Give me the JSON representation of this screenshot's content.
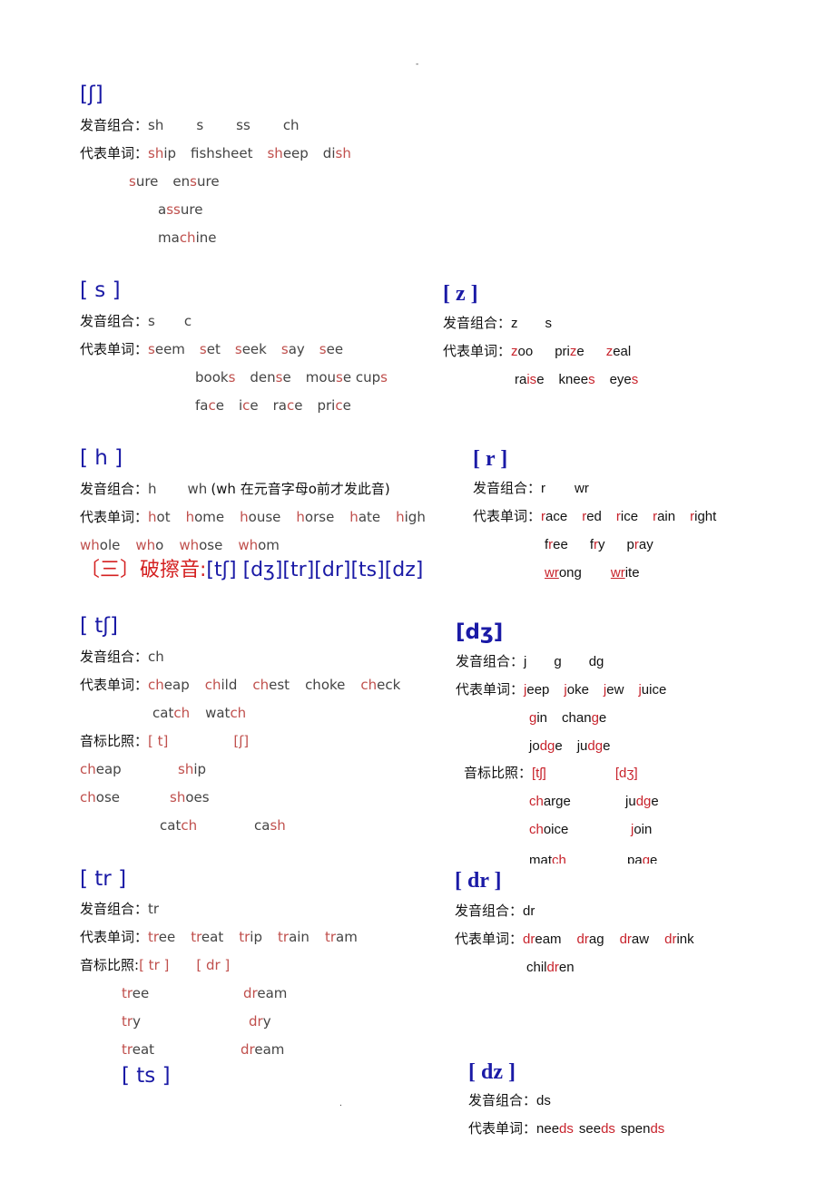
{
  "page_marks": {
    "top": "-",
    "bottom": "."
  },
  "labels": {
    "combo": "发音组合：",
    "words": "代表单词：",
    "compare": "音标比照：",
    "compare_tight": "音标比照:"
  },
  "heading": {
    "prefix": "〔三〕破擦音:",
    "symbols": "[tʃ] [dʒ][tr][dr][ts][dz]"
  },
  "colors": {
    "symbol": "#1a1aa6",
    "highlight": "#c0504d",
    "heading": "#d42020"
  },
  "sh": {
    "symbol": "[ʃ]",
    "combos": [
      "sh",
      "s",
      "ss",
      "ch"
    ],
    "words": [
      [
        "",
        "sh",
        "ip"
      ],
      [
        "fishsheet"
      ],
      [
        "",
        "sh",
        "eep"
      ],
      [
        "di",
        "sh"
      ]
    ],
    "words2": [
      [
        "",
        "s",
        "ure"
      ],
      [
        "en",
        "s",
        "ure"
      ]
    ],
    "words3": [
      [
        "a",
        "ss",
        "ure"
      ]
    ],
    "words4": [
      [
        "ma",
        "ch",
        "ine"
      ]
    ]
  },
  "s": {
    "symbol": "[ s ]",
    "combos": [
      "s",
      "c"
    ],
    "words": [
      [
        "",
        "s",
        "eem"
      ],
      [
        "",
        "s",
        "et"
      ],
      [
        "",
        "s",
        "eek"
      ],
      [
        "",
        "s",
        "ay"
      ],
      [
        "",
        "s",
        "ee"
      ]
    ],
    "words2": [
      [
        "book",
        "s"
      ],
      [
        "den",
        "s",
        "e"
      ],
      [
        "mou",
        "s",
        "e cup",
        "s"
      ]
    ],
    "words3": [
      [
        "fa",
        "c",
        "e"
      ],
      [
        "i",
        "c",
        "e"
      ],
      [
        "ra",
        "c",
        "e"
      ],
      [
        "pri",
        "c",
        "e"
      ]
    ]
  },
  "z": {
    "symbol": "[ z ]",
    "combos": [
      "z",
      "s"
    ],
    "words": [
      [
        "",
        "z",
        "oo"
      ],
      [
        "pri",
        "z",
        "e"
      ],
      [
        "",
        "z",
        "eal"
      ]
    ],
    "words2": [
      [
        "ra",
        "is",
        "e"
      ],
      [
        "knee",
        "s"
      ],
      [
        "eye",
        "s"
      ]
    ]
  },
  "h": {
    "symbol": "[ h ]",
    "combos": [
      "h",
      "wh"
    ],
    "note": "(wh  在元音字母o前才发此音)",
    "words": [
      [
        "",
        "h",
        "ot"
      ],
      [
        "",
        "h",
        "ome"
      ],
      [
        "",
        "h",
        "ouse"
      ],
      [
        "",
        "h",
        "orse"
      ],
      [
        "",
        "h",
        "ate"
      ],
      [
        "",
        "h",
        "igh"
      ]
    ],
    "words2": [
      [
        "",
        "wh",
        "ole"
      ],
      [
        "",
        "wh",
        "o"
      ],
      [
        "",
        "wh",
        "ose"
      ],
      [
        "",
        "wh",
        "om"
      ]
    ]
  },
  "r": {
    "symbol": "[ r ]",
    "combos": [
      "r",
      "wr"
    ],
    "words": [
      [
        "",
        "r",
        "ace"
      ],
      [
        "",
        "r",
        "ed"
      ],
      [
        "",
        "r",
        "ice"
      ],
      [
        "",
        "r",
        "ain"
      ],
      [
        "",
        "r",
        "ight"
      ]
    ],
    "words2": [
      [
        "f",
        "r",
        "ee"
      ],
      [
        "f",
        "r",
        "y"
      ],
      [
        "p",
        "r",
        "ay"
      ]
    ],
    "words3": [
      [
        "",
        "wr",
        "ong"
      ],
      [
        "",
        "wr",
        "ite"
      ]
    ]
  },
  "tsh": {
    "symbol": "[ tʃ]",
    "combos": [
      "ch"
    ],
    "words": [
      [
        "",
        "ch",
        "eap"
      ],
      [
        "",
        "ch",
        "ild"
      ],
      [
        "",
        "ch",
        "est"
      ],
      [
        "choke"
      ],
      [
        "",
        "ch",
        "eck"
      ]
    ],
    "words2": [
      [
        "cat",
        "ch"
      ],
      [
        "wat",
        "ch"
      ]
    ],
    "compare": [
      [
        "",
        "[ t]"
      ],
      [
        "",
        "[ʃ]"
      ]
    ],
    "pairs": [
      [
        [
          "",
          "ch",
          "eap"
        ],
        [
          "",
          "sh",
          "ip"
        ]
      ],
      [
        [
          "",
          "ch",
          "ose"
        ],
        [
          "",
          "sh",
          "oes"
        ]
      ],
      [
        [
          "cat",
          "ch"
        ],
        [
          "ca",
          "sh"
        ]
      ]
    ]
  },
  "dzh": {
    "symbol": "[dʒ]",
    "combos": [
      "j",
      "g",
      "dg"
    ],
    "words": [
      [
        "",
        "j",
        "eep"
      ],
      [
        "",
        "j",
        "oke"
      ],
      [
        "",
        "j",
        "ew"
      ],
      [
        "",
        "j",
        "uice"
      ]
    ],
    "words2": [
      [
        "",
        "g",
        "in"
      ],
      [
        "chan",
        "g",
        "e"
      ]
    ],
    "words3": [
      [
        "jo",
        "dg",
        "e"
      ],
      [
        "ju",
        "dg",
        "e"
      ]
    ],
    "compare": [
      [
        "",
        "[tʃ]"
      ],
      [
        "",
        "[dʒ]"
      ]
    ],
    "pairs": [
      [
        [
          "",
          "ch",
          "arge"
        ],
        [
          "ju",
          "dg",
          "e"
        ]
      ],
      [
        [
          "",
          "ch",
          "oice"
        ],
        [
          "",
          "j",
          "oin"
        ]
      ],
      [
        [
          "mat",
          "ch"
        ],
        [
          "pa",
          "g",
          "e"
        ]
      ]
    ]
  },
  "tr": {
    "symbol": "[ tr ]",
    "combos": [
      "tr"
    ],
    "words": [
      [
        "",
        "tr",
        "ee"
      ],
      [
        "",
        "tr",
        "eat"
      ],
      [
        "",
        "tr",
        "ip"
      ],
      [
        "",
        "tr",
        "ain"
      ],
      [
        "",
        "tr",
        "am"
      ]
    ],
    "compare": [
      [
        "",
        "[ tr ]"
      ],
      [
        "",
        "[ dr ]"
      ]
    ],
    "pairs": [
      [
        [
          "",
          "tr",
          "ee"
        ],
        [
          "",
          "dr",
          "eam"
        ]
      ],
      [
        [
          "",
          "tr",
          "y"
        ],
        [
          "",
          "dr",
          "y"
        ]
      ],
      [
        [
          "",
          "tr",
          "eat"
        ],
        [
          "",
          "dr",
          "eam"
        ]
      ]
    ]
  },
  "ts": {
    "symbol": "[ ts ]"
  },
  "dr": {
    "symbol": "[ dr ]",
    "combos": [
      "dr"
    ],
    "words": [
      [
        "",
        "dr",
        "eam"
      ],
      [
        "",
        "dr",
        "ag"
      ],
      [
        "",
        "dr",
        "aw"
      ],
      [
        "",
        "dr",
        "ink"
      ]
    ],
    "words2": [
      [
        "chil",
        "dr",
        "en"
      ]
    ]
  },
  "dz": {
    "symbol": "[ dz ]",
    "combos": [
      "ds"
    ],
    "words": [
      [
        "nee",
        "ds"
      ],
      [
        "see",
        "ds"
      ],
      [
        "spen",
        "ds"
      ]
    ]
  }
}
